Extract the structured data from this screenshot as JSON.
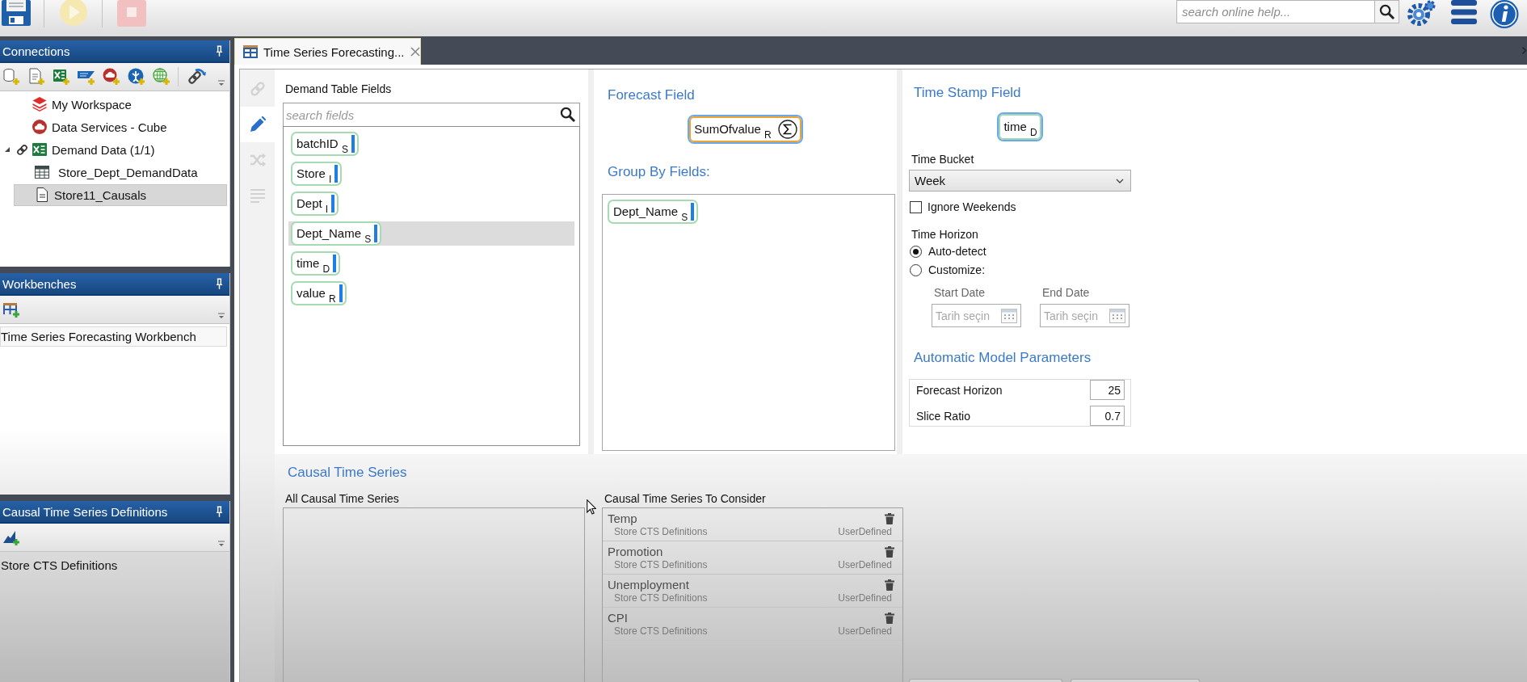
{
  "toolbar": {
    "buttons": [
      {
        "kind": "save",
        "disabled": false
      },
      {
        "kind": "run",
        "disabled": true
      },
      {
        "kind": "stop",
        "disabled": true
      }
    ],
    "help_search": {
      "placeholder": "search online help..."
    }
  },
  "connections": {
    "title": "Connections",
    "tree": [
      {
        "label": "My Workspace",
        "kind": "workspace",
        "linked": false,
        "selected": false
      },
      {
        "label": "Data Services - Cube",
        "kind": "cloud",
        "linked": false,
        "selected": false
      },
      {
        "label": "Demand Data (1/1)",
        "kind": "spreadsheet",
        "linked": true,
        "selected": false,
        "expanded": true,
        "children": [
          {
            "label": "Store_Dept_DemandData",
            "kind": "table",
            "selected": false
          },
          {
            "label": "Store11_Causals",
            "kind": "document",
            "selected": true
          }
        ]
      }
    ]
  },
  "workbenches": {
    "title": "Workbenches",
    "items": [
      {
        "label": "Time Series Forecasting Workbench",
        "selected": true
      }
    ]
  },
  "cts_definitions": {
    "title": "Causal Time Series Definitions",
    "items": [
      {
        "label": "Store CTS Definitions",
        "selected": false
      }
    ]
  },
  "tabs": [
    {
      "label": "Time Series Forecasting...",
      "selected": true
    }
  ],
  "side_nav": [
    {
      "kind": "link",
      "selected": false
    },
    {
      "kind": "edit",
      "selected": true
    },
    {
      "kind": "shuffle",
      "selected": false
    },
    {
      "kind": "list",
      "selected": false
    }
  ],
  "demand_fields": {
    "title": "Demand Table Fields",
    "search": {
      "placeholder": "search fields"
    },
    "fields": [
      {
        "name": "batchID",
        "type": "S",
        "selected": false
      },
      {
        "name": "Store",
        "type": "I",
        "selected": false
      },
      {
        "name": "Dept",
        "type": "I",
        "selected": false
      },
      {
        "name": "Dept_Name",
        "type": "S",
        "selected": true
      },
      {
        "name": "time",
        "type": "D",
        "selected": false
      },
      {
        "name": "value",
        "type": "R",
        "selected": false
      }
    ]
  },
  "forecast_field": {
    "title": "Forecast Field",
    "field": {
      "name": "SumOfvalue",
      "type": "R"
    }
  },
  "group_by": {
    "title": "Group By Fields:",
    "fields": [
      {
        "name": "Dept_Name",
        "type": "S"
      }
    ]
  },
  "time_stamp": {
    "title": "Time Stamp Field",
    "field": {
      "name": "time",
      "type": "D"
    },
    "time_bucket": {
      "label": "Time Bucket",
      "value": "Week"
    },
    "ignore_weekends": {
      "label": "Ignore Weekends",
      "checked": false
    },
    "time_horizon": {
      "label": "Time Horizon",
      "options": [
        {
          "label": "Auto-detect",
          "selected": true
        },
        {
          "label": "Customize:",
          "selected": false
        }
      ]
    },
    "dates": [
      {
        "label": "Start Date",
        "placeholder": "Tarih seçin",
        "disabled": true
      },
      {
        "label": "End Date",
        "placeholder": "Tarih seçin",
        "disabled": true
      }
    ]
  },
  "model_parameters": {
    "title": "Automatic Model Parameters",
    "rows": [
      {
        "label": "Forecast Horizon",
        "value": "25"
      },
      {
        "label": "Slice Ratio",
        "value": "0.7"
      }
    ]
  },
  "causal_series": {
    "title": "Causal Time Series",
    "available": {
      "title": "All Causal Time Series"
    },
    "to_consider": {
      "title": "Causal Time Series To Consider",
      "items": [
        {
          "name": "Temp",
          "source": "Store CTS Definitions",
          "type": "UserDefined"
        },
        {
          "name": "Promotion",
          "source": "Store CTS Definitions",
          "type": "UserDefined"
        },
        {
          "name": "Unemployment",
          "source": "Store CTS Definitions",
          "type": "UserDefined"
        },
        {
          "name": "CPI",
          "source": "Store CTS Definitions",
          "type": "UserDefined"
        }
      ]
    }
  }
}
